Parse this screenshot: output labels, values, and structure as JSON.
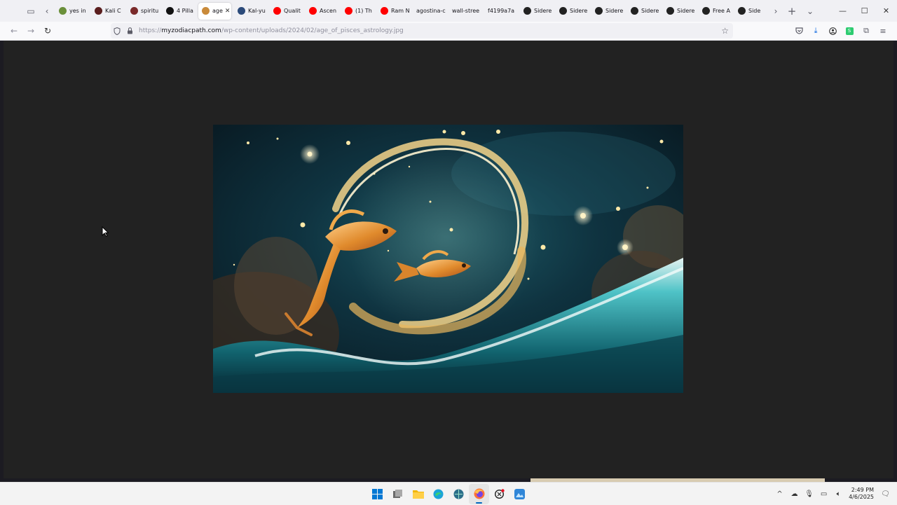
{
  "browser": {
    "tabs": [
      {
        "label": "yes in",
        "favicon": "leaf-icon",
        "favicon_color": "#6a8f3a",
        "active": false
      },
      {
        "label": "Kali C",
        "favicon": "circle-logo-icon",
        "favicon_color": "#5a1e1e",
        "active": false
      },
      {
        "label": "spiritu",
        "favicon": "circle-logo-icon",
        "favicon_color": "#7a2a2a",
        "active": false
      },
      {
        "label": "4 Pilla",
        "favicon": "m-logo-icon",
        "favicon_color": "#111111",
        "active": false
      },
      {
        "label": "age",
        "favicon": "zodiac-icon",
        "favicon_color": "#c98a3a",
        "active": true
      },
      {
        "label": "Kal-yu",
        "favicon": "image-icon",
        "favicon_color": "#2b4a7a",
        "active": false
      },
      {
        "label": "Qualit",
        "favicon": "youtube-icon",
        "favicon_color": "#ff0000",
        "active": false
      },
      {
        "label": "Ascen",
        "favicon": "youtube-icon",
        "favicon_color": "#ff0000",
        "active": false
      },
      {
        "label": "(1) Th",
        "favicon": "youtube-icon",
        "favicon_color": "#ff0000",
        "active": false
      },
      {
        "label": "Ram N",
        "favicon": "youtube-icon",
        "favicon_color": "#ff0000",
        "active": false
      },
      {
        "label": "agostina-c",
        "favicon": "",
        "favicon_color": "",
        "active": false
      },
      {
        "label": "wall-stree",
        "favicon": "",
        "favicon_color": "",
        "active": false
      },
      {
        "label": "f4199a7a",
        "favicon": "",
        "favicon_color": "",
        "active": false
      },
      {
        "label": "Sidere",
        "favicon": "square-logo-icon",
        "favicon_color": "#222222",
        "active": false
      },
      {
        "label": "Sidere",
        "favicon": "square-logo-icon",
        "favicon_color": "#222222",
        "active": false
      },
      {
        "label": "Sidere",
        "favicon": "square-logo-icon",
        "favicon_color": "#222222",
        "active": false
      },
      {
        "label": "Sidere",
        "favicon": "square-logo-icon",
        "favicon_color": "#222222",
        "active": false
      },
      {
        "label": "Sidere",
        "favicon": "square-logo-icon",
        "favicon_color": "#222222",
        "active": false
      },
      {
        "label": "Free A",
        "favicon": "square-logo-icon",
        "favicon_color": "#222222",
        "active": false
      },
      {
        "label": "Side",
        "favicon": "square-logo-icon",
        "favicon_color": "#222222",
        "active": false
      }
    ],
    "url": {
      "scheme": "https://",
      "host": "myzodiacpath.com",
      "path": "/wp-content/uploads/2024/02/age_of_pisces_astrology.jpg"
    }
  },
  "taskbar": {
    "apps": [
      {
        "name": "windows-start-icon",
        "active": false
      },
      {
        "name": "task-view-icon",
        "active": false
      },
      {
        "name": "file-explorer-icon",
        "active": false
      },
      {
        "name": "edge-icon",
        "active": false
      },
      {
        "name": "globe-browser-icon",
        "active": false
      },
      {
        "name": "firefox-icon",
        "active": true
      },
      {
        "name": "chatgpt-icon",
        "active": false
      },
      {
        "name": "photos-icon",
        "active": false
      }
    ],
    "clock": {
      "time": "2:49 PM",
      "date": "4/6/2025"
    }
  },
  "colors": {
    "accent": "#0067c0",
    "content_bg": "#222222",
    "firefox_orange": "#ff7139"
  }
}
